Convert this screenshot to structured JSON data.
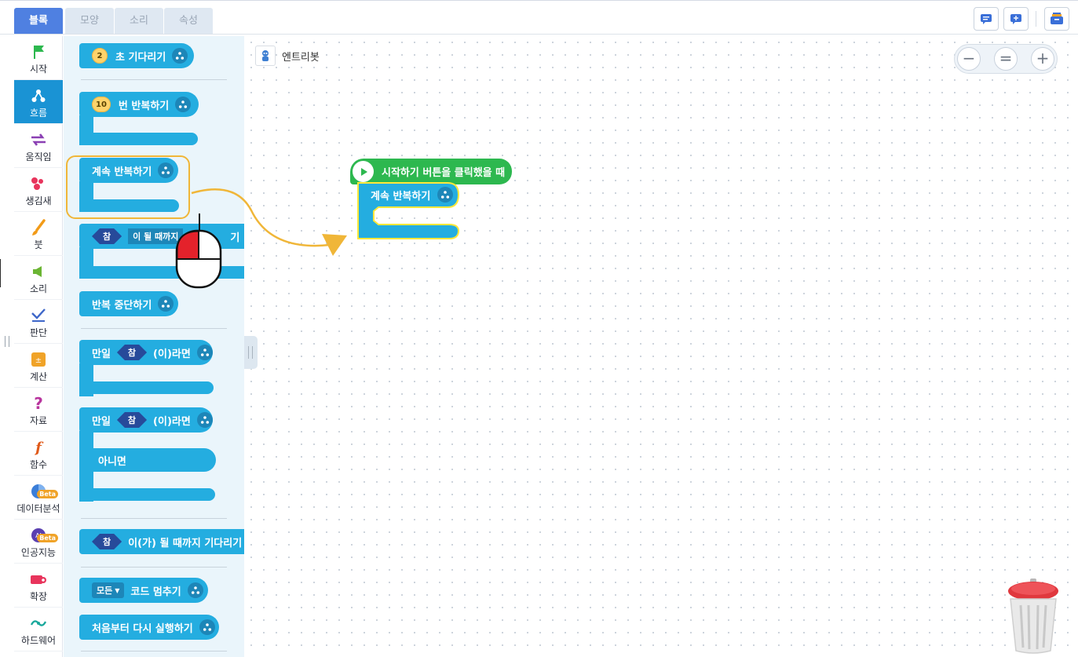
{
  "tabs": [
    {
      "label": "블록",
      "active": true
    },
    {
      "label": "모양",
      "active": false
    },
    {
      "label": "소리",
      "active": false
    },
    {
      "label": "속성",
      "active": false
    }
  ],
  "toolbar": {
    "buttons": [
      "comment-icon",
      "add-comment-icon",
      "storage-icon"
    ]
  },
  "categories": [
    {
      "label": "시작",
      "icon": "flag-icon",
      "active": false
    },
    {
      "label": "흐름",
      "icon": "flow-icon",
      "active": true
    },
    {
      "label": "움직임",
      "icon": "move-arrows-icon",
      "active": false
    },
    {
      "label": "생김새",
      "icon": "looks-icon",
      "active": false
    },
    {
      "label": "붓",
      "icon": "brush-icon",
      "active": false
    },
    {
      "label": "소리",
      "icon": "speaker-icon",
      "active": false
    },
    {
      "label": "판단",
      "icon": "check-icon",
      "active": false
    },
    {
      "label": "계산",
      "icon": "calculator-icon",
      "active": false
    },
    {
      "label": "자료",
      "icon": "question-icon",
      "active": false
    },
    {
      "label": "함수",
      "icon": "function-icon",
      "active": false
    },
    {
      "label": "데이터분석",
      "icon": "pie-chart-icon",
      "active": false,
      "badge": "Beta"
    },
    {
      "label": "인공지능",
      "icon": "ai-icon",
      "active": false,
      "badge": "Beta"
    },
    {
      "label": "확장",
      "icon": "extension-icon",
      "active": false
    },
    {
      "label": "하드웨어",
      "icon": "hardware-icon",
      "active": false
    }
  ],
  "palette": {
    "wait": {
      "value": "2",
      "text": "초 기다리기"
    },
    "repeat_n": {
      "value": "10",
      "text": "번 반복하기"
    },
    "repeat_forever": {
      "text": "계속 반복하기"
    },
    "repeat_until": {
      "chip": "참",
      "text": "이 될 때까지",
      "text_tail": "기"
    },
    "break_loop": {
      "text": "반복 중단하기"
    },
    "if_then": {
      "prefix": "만일",
      "chip": "참",
      "suffix": "(이)라면"
    },
    "if_else": {
      "prefix": "만일",
      "chip": "참",
      "suffix": "(이)라면",
      "else": "아니면"
    },
    "wait_until": {
      "chip": "참",
      "text": "이(가) 될 때까지 기다리기"
    },
    "stop_code": {
      "dropdown": "모든",
      "text": "코드 멈추기"
    },
    "restart": {
      "text": "처음부터 다시 실행하기"
    }
  },
  "workspace": {
    "object_name": "엔트리봇",
    "zoom_buttons": [
      "−",
      "=",
      "+"
    ],
    "hat_block": "시작하기 버튼을 클릭했을 때",
    "loop_block": "계속 반복하기"
  }
}
